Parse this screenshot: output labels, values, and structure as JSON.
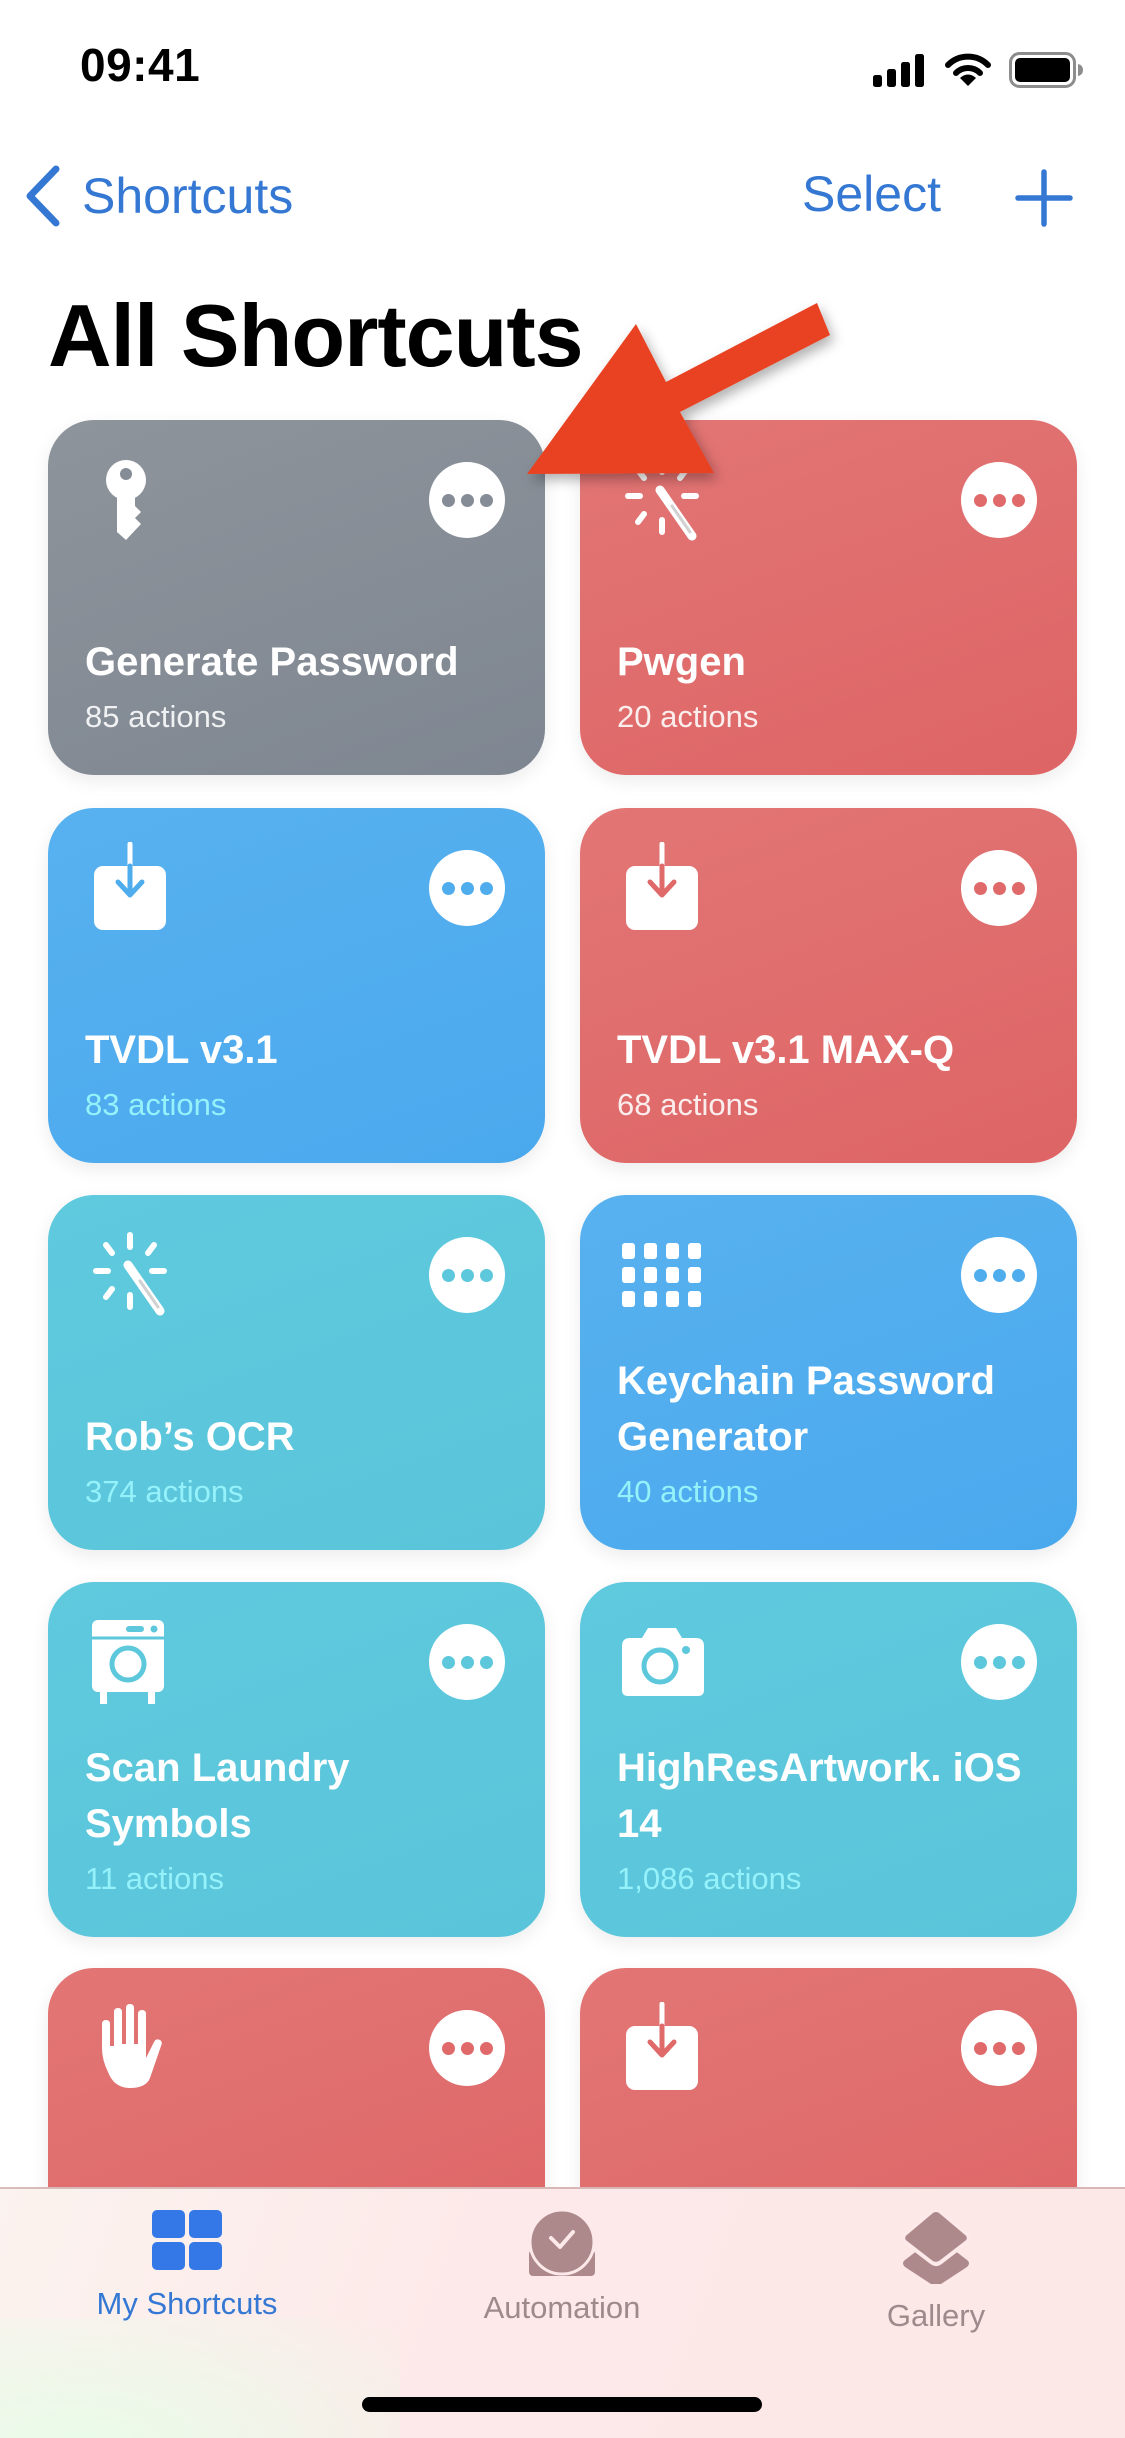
{
  "status_bar": {
    "time": "09:41",
    "icons": [
      "cellular-signal-icon",
      "wifi-icon",
      "battery-icon"
    ]
  },
  "nav": {
    "back_label": "Shortcuts",
    "select_label": "Select",
    "add_icon": "plus-icon"
  },
  "page_title": "All Shortcuts",
  "colors": {
    "accent": "#3478d4",
    "card_gray": "#878e97",
    "card_red": "#e06c6c",
    "card_blue": "#4fadee",
    "card_teal": "#5dc7dc",
    "annotation_arrow": "#e84324",
    "tab_inactive": "#9e8a8c"
  },
  "shortcuts": [
    {
      "title": "Generate Password",
      "actions": "85 actions",
      "icon": "key-icon",
      "color": "gray"
    },
    {
      "title": "Pwgen",
      "actions": "20 actions",
      "icon": "magic-wand-icon",
      "color": "red"
    },
    {
      "title": "TVDL v3.1",
      "actions": "83 actions",
      "icon": "download-tray-icon",
      "color": "blue"
    },
    {
      "title": "TVDL v3.1 MAX-Q",
      "actions": "68 actions",
      "icon": "download-tray-icon",
      "color": "red"
    },
    {
      "title": "Rob’s OCR",
      "actions": "374 actions",
      "icon": "magic-wand-icon",
      "color": "teal"
    },
    {
      "title": "Keychain Password Generator",
      "actions": "40 actions",
      "icon": "keypad-grid-icon",
      "color": "blue"
    },
    {
      "title": "Scan Laundry Symbols",
      "actions": "11 actions",
      "icon": "washing-machine-icon",
      "color": "teal"
    },
    {
      "title": "HighResArtwork. iOS 14",
      "actions": "1,086 actions",
      "icon": "camera-icon",
      "color": "teal"
    },
    {
      "title": "",
      "actions": "",
      "icon": "hand-raised-icon",
      "color": "red"
    },
    {
      "title": "",
      "actions": "",
      "icon": "download-tray-icon",
      "color": "red"
    }
  ],
  "more_button_icon": "ellipsis-icon",
  "tabs": [
    {
      "label": "My Shortcuts",
      "icon": "grid-squares-icon",
      "active": true
    },
    {
      "label": "Automation",
      "icon": "clock-check-icon",
      "active": false
    },
    {
      "label": "Gallery",
      "icon": "layers-icon",
      "active": false
    }
  ],
  "annotation": {
    "type": "arrow",
    "points_to": "Generate Password more button"
  }
}
